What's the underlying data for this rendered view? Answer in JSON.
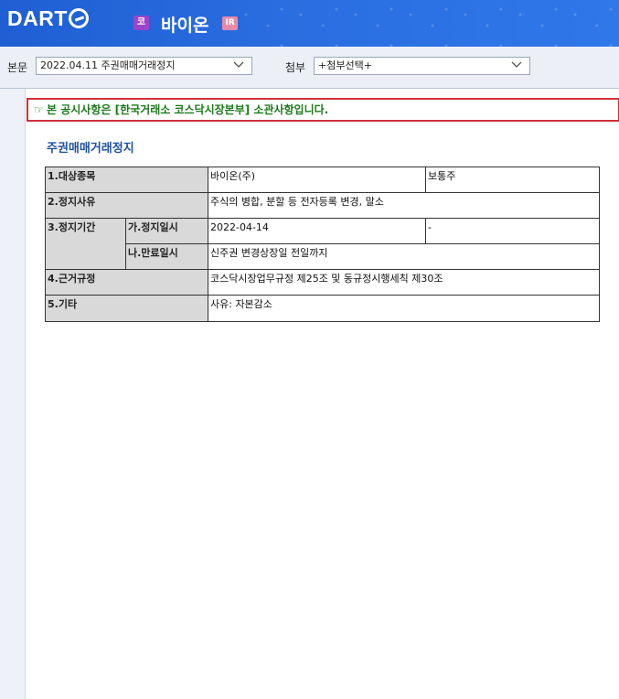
{
  "header": {
    "logo": "DART",
    "market_badge": "코",
    "company": "바이온",
    "ir_badge": "IR",
    "colors": {
      "bar": "#2a6de0",
      "market_badge": "#9a45c9",
      "ir_badge": "#e98aa8"
    }
  },
  "toolbar": {
    "body_label": "본문",
    "body_select": "2022.04.11  주권매매거래정지",
    "attach_label": "첨부",
    "attach_select": "+첨부선택+"
  },
  "notice": {
    "icon": "pointing-hand-icon",
    "text": "본 공시사항은 [한국거래소 코스닥시장본부] 소관사항입니다."
  },
  "document": {
    "title": "주권매매거래정지",
    "rows": {
      "item": {
        "label": "1.대상종목",
        "value": "바이온(주)",
        "extra": "보통주"
      },
      "reason": {
        "label": "2.정지사유",
        "value": "주식의 병합, 분할 등 전자등록 변경, 말소"
      },
      "period": {
        "label": "3.정지기간",
        "start_label": "가.정지일시",
        "start_value": "2022-04-14",
        "start_extra": "-",
        "end_label": "나.만료일시",
        "end_value": "신주권 변경상장일 전일까지"
      },
      "basis": {
        "label": "4.근거규정",
        "value": "코스닥시장업무규정 제25조 및 동규정시행세칙 제30조"
      },
      "other": {
        "label": "5.기타",
        "value": "사유: 자본감소"
      }
    }
  }
}
